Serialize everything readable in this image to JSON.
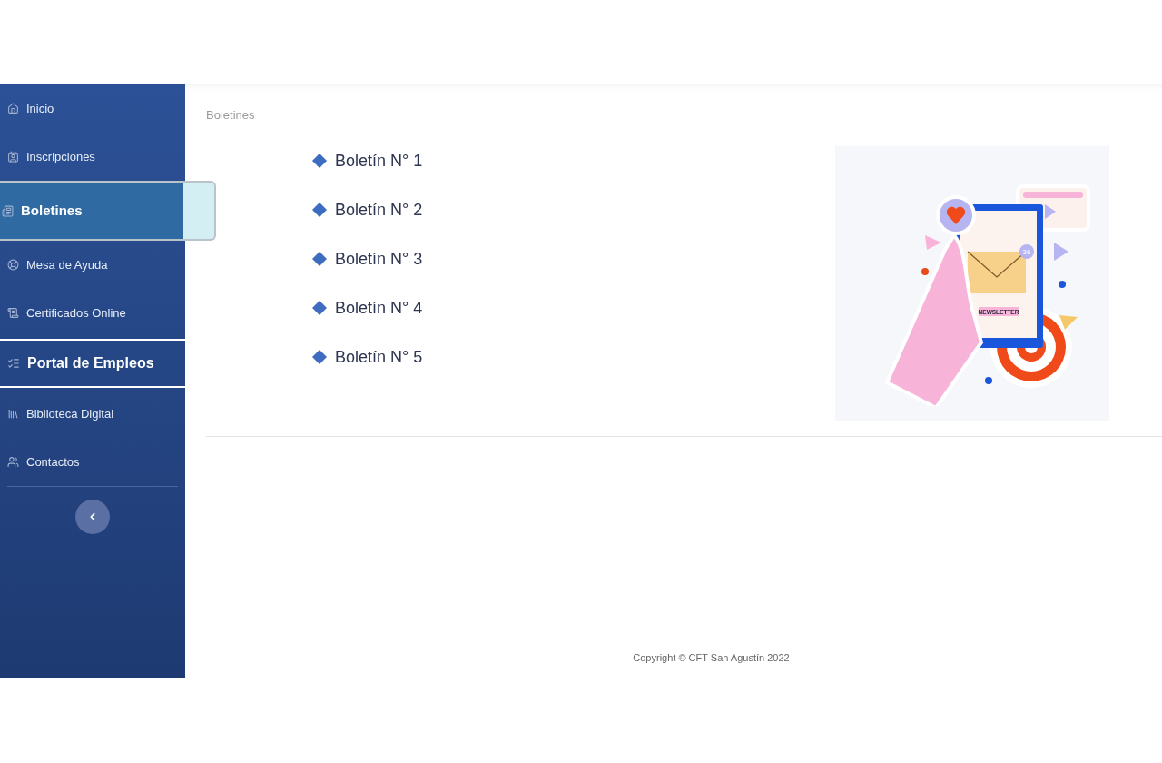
{
  "sidebar": {
    "items": [
      {
        "kind": "link",
        "label": "Inicio",
        "selected": false
      },
      {
        "kind": "link",
        "label": "Inscripciones",
        "selected": false
      },
      {
        "kind": "link",
        "label": "Boletines",
        "selected": true
      },
      {
        "kind": "link",
        "label": "Mesa de Ayuda",
        "selected": false
      },
      {
        "kind": "link",
        "label": "Certificados Online",
        "selected": false
      },
      {
        "kind": "section",
        "label": "Portal de Empleos",
        "selected": false
      },
      {
        "kind": "link",
        "label": "Biblioteca Digital",
        "selected": false
      },
      {
        "kind": "link",
        "label": "Contactos",
        "selected": false
      }
    ]
  },
  "breadcrumb": "Boletines",
  "bulletins": [
    "Boletín N° 1",
    "Boletín N° 2",
    "Boletín N° 3",
    "Boletín N° 4",
    "Boletín N° 5"
  ],
  "illustration": {
    "label": "NEWSLETTER",
    "badge": "36"
  },
  "footer": "Copyright © CFT San Agustín 2022"
}
